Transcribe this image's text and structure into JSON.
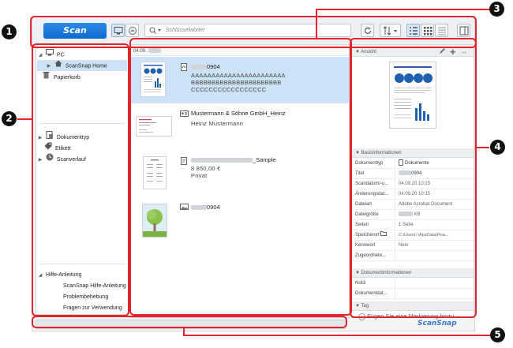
{
  "toolbar": {
    "scan_label": "Scan",
    "search_placeholder": "Schlüsselwörter"
  },
  "sidebar": {
    "pc": "PC",
    "scansnap_home": "ScanSnap Home",
    "trash": "Papierkorb",
    "doc_type": "Dokumenttyp",
    "tag": "Etikett",
    "history": "Scanverlauf",
    "help_title": "Hilfe-Anleitung",
    "help_items": [
      "ScanSnap Hilfe-Anleitung",
      "Problembehebung",
      "Fragen zur Verwendung"
    ]
  },
  "list": {
    "date_header": "04.09.",
    "items": [
      {
        "title_suffix": "0904",
        "lines": [
          "AAAAAAAAAAAAAAAAAAAAAAA",
          "BBBBBBBBBBBBBBBBBBBBBB",
          "CCCCCCCCCCCCCCCCC"
        ]
      },
      {
        "title": "Mustermann & Söhne GmbH_Heinz",
        "lines": [
          "Heinz Mustermann"
        ]
      },
      {
        "title_suffix": "_Sample",
        "lines": [
          "8 850,00 €",
          "Privat"
        ]
      },
      {
        "title_suffix": "0904",
        "lines": []
      }
    ]
  },
  "detail": {
    "view_header": "Ansicht",
    "basic_header": "Basisinformationen",
    "props": [
      {
        "k": "Dokumenttyp",
        "v": "Dokumente"
      },
      {
        "k": "Titel",
        "v": "0904"
      },
      {
        "k": "Scandatum/-u...",
        "v": "04.09.20   10:15"
      },
      {
        "k": "Änderungsdat...",
        "v": "04.09.20   10:15"
      },
      {
        "k": "Dateiart",
        "v": "Adobe Acrobat Document"
      },
      {
        "k": "Dateigröße",
        "v": "KB"
      },
      {
        "k": "Seiten",
        "v": "1 Seite"
      },
      {
        "k": "Speicherort",
        "v": "C:\\Users\\         \\AppData\\Roa..."
      },
      {
        "k": "Kennwort",
        "v": "Nein"
      },
      {
        "k": "Zugeordnete...",
        "v": ""
      }
    ],
    "docinfo_header": "Dokumentinformationen",
    "docinfo": [
      {
        "k": "Notiz",
        "v": ""
      },
      {
        "k": "Dokumentdat...",
        "v": ""
      }
    ],
    "tag_header": "Tag",
    "add_tag": "Fügen Sie eine Markierung hinzu"
  },
  "brand": "ScanSnap",
  "callouts": [
    "1",
    "2",
    "3",
    "4",
    "5"
  ]
}
